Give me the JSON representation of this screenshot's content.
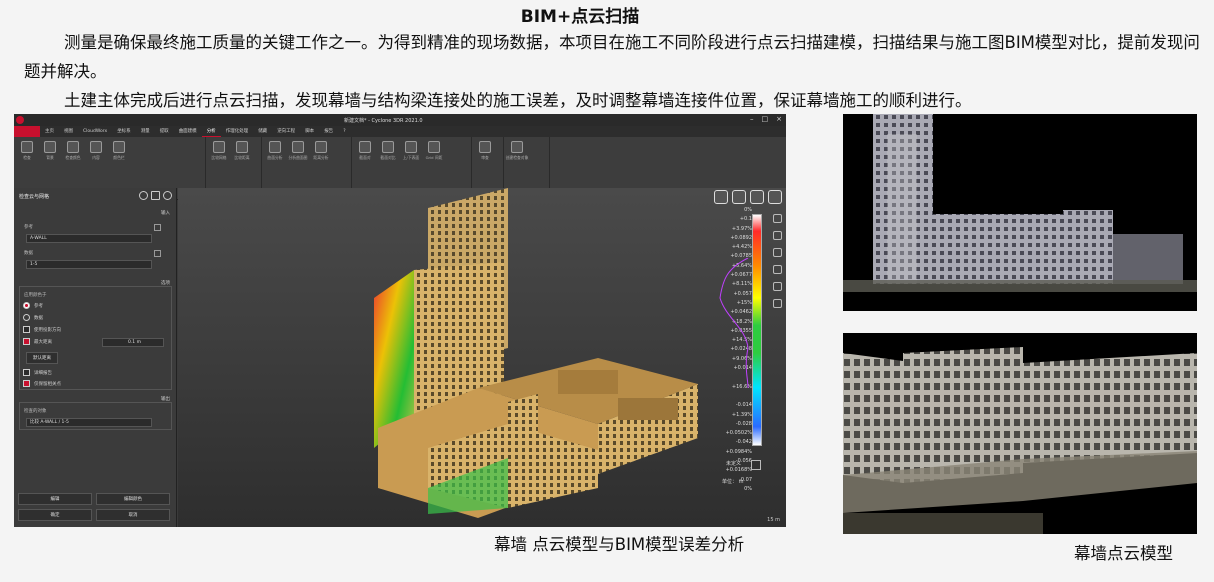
{
  "slide": {
    "title": "BIM+点云扫描",
    "para1": "测量是确保最终施工质量的关键工作之一。为得到精准的现场数据，本项目在施工不同阶段进行点云扫描建模，扫描结果与施工图BIM模型对比，提前发现问题并解决。",
    "para2": "土建主体完成后进行点云扫描，发现幕墙与结构梁连接处的施工误差，及时调整幕墙连接件位置，保证幕墙施工的顺利进行。",
    "caption_left": "幕墙 点云模型与BIM模型误差分析",
    "caption_right": "幕墙点云模型"
  },
  "app": {
    "window_title": "新建文档* - Cyclone 3DR 2021.0",
    "menu": [
      "主页",
      "视图",
      "CloudWorx",
      "坐标系",
      "测量",
      "提取",
      "曲面建模",
      "分析",
      "作理化处理",
      "储藏",
      "逆向工程",
      "脚本",
      "报告",
      "?"
    ],
    "active_menu": "分析",
    "ribbon_groups": [
      {
        "label": "",
        "buttons": [
          "检查",
          "背景",
          "检查颜色",
          "内容",
          "颜色栏"
        ]
      },
      {
        "label": "测量",
        "buttons": [
          "比较网格",
          "比较距离"
        ]
      },
      {
        "label": "曲面分析",
        "buttons": [
          "曲面分析",
          "分析曲面图",
          "距离分析"
        ]
      },
      {
        "label": "截面",
        "buttons": [
          "截面对",
          "截面对比",
          "上/下表面",
          "Grid 间距"
        ]
      },
      {
        "label": "GD",
        "buttons": [
          "审查"
        ]
      },
      {
        "label": "检查",
        "buttons": [
          "创建检查对象"
        ]
      }
    ],
    "panel": {
      "title": "检查云与网格",
      "section_input": "输入",
      "label_reference": "参考",
      "reference_value": "A-WALL",
      "label_data": "数据",
      "data_value": "1-5",
      "section_options": "选项",
      "label_colorize": "应用颜色于",
      "opt_reference": "参考",
      "opt_data": "数据",
      "opt_proj": "使用投影方向",
      "opt_maxdist": "最大距离",
      "maxdist_value": "0.1 m",
      "btn_default_dist": "默认距离",
      "opt_detail": "详细报告",
      "opt_keep": "仅保留相关点",
      "section_output": "输出",
      "label_output_obj": "检查的对象",
      "output_value": "比较 A-WALL / 1-5",
      "btn_edit": "编辑",
      "btn_edit_color": "编辑颜色",
      "btn_ok": "确定",
      "btn_cancel": "取消"
    },
    "colorbar_labels": [
      "0%",
      "+0.1",
      "+3.97%",
      "+0.0892",
      "+4.42%",
      "+0.0785",
      "+5.64%",
      "+0.0677",
      "+8.11%",
      "+0.057",
      "+15%",
      "+0.0462",
      "+18.2%",
      "+0.0355",
      "+14.5%",
      "+0.0248",
      "+9.06%",
      "+0.014",
      "",
      "+16.6%",
      "",
      "-0.014",
      "+1.39%",
      "-0.028",
      "+0.0502%",
      "-0.042",
      "+0.0984%",
      "-0.056",
      "+0.0168%",
      "-0.07",
      "0%"
    ],
    "undefined_label": "未定义",
    "unit_label": "单位： m",
    "scale_label": "15 m"
  }
}
